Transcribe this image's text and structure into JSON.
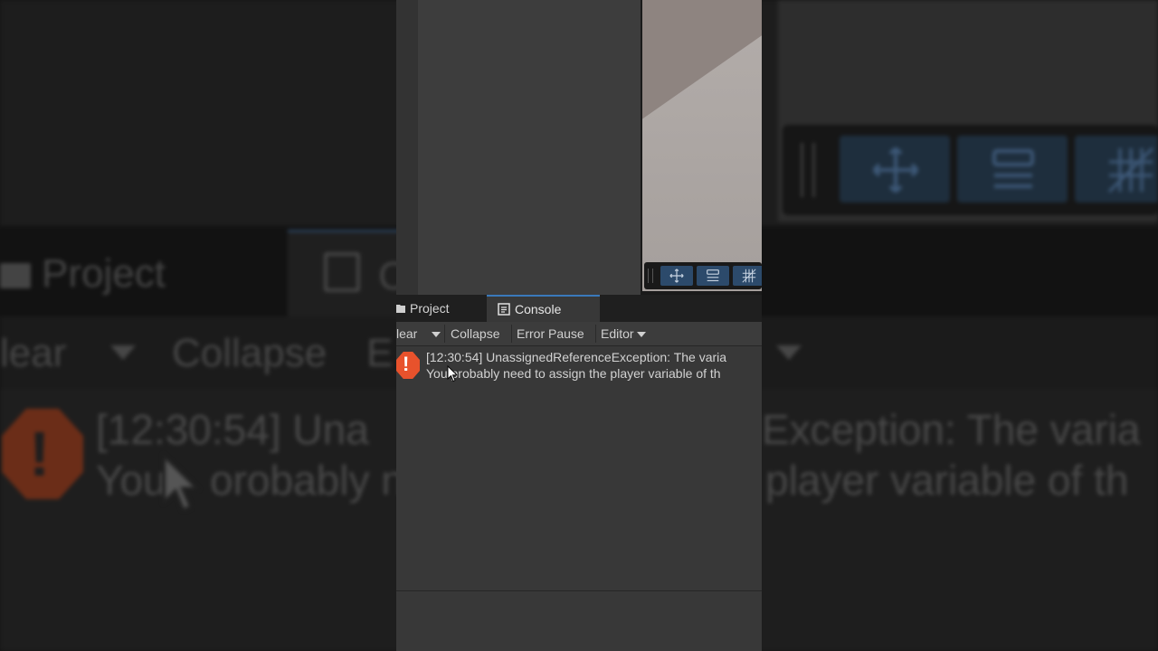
{
  "background": {
    "tab_project": "Project",
    "tab_console_partial": "C",
    "toolbar_clear": "lear",
    "toolbar_collapse": "Collapse",
    "toolbar_partial": "E",
    "log_line1_left": "[12:30:54] Una",
    "log_line1_right": "Exception: The varia",
    "log_line2_left": "You",
    "log_line2_mid": "orobably n",
    "log_line2_right": "player variable of th"
  },
  "tabs": {
    "project": "Project",
    "console": "Console"
  },
  "toolbar": {
    "clear": "lear",
    "collapse": "Collapse",
    "error_pause": "Error Pause",
    "editor": "Editor"
  },
  "console": {
    "log_line1": "[12:30:54] UnassignedReferenceException: The varia",
    "log_line2": "You probably need to assign the player variable of th"
  },
  "colors": {
    "error_icon": "#e8522c",
    "active_tab_accent": "#3a79bb",
    "scene_tool_button": "#2c4a6b"
  },
  "icons": [
    "folder-icon",
    "console-icon",
    "error-icon",
    "move-tool-icon",
    "settings-tool-icon",
    "grid-tool-icon",
    "cursor-icon"
  ]
}
